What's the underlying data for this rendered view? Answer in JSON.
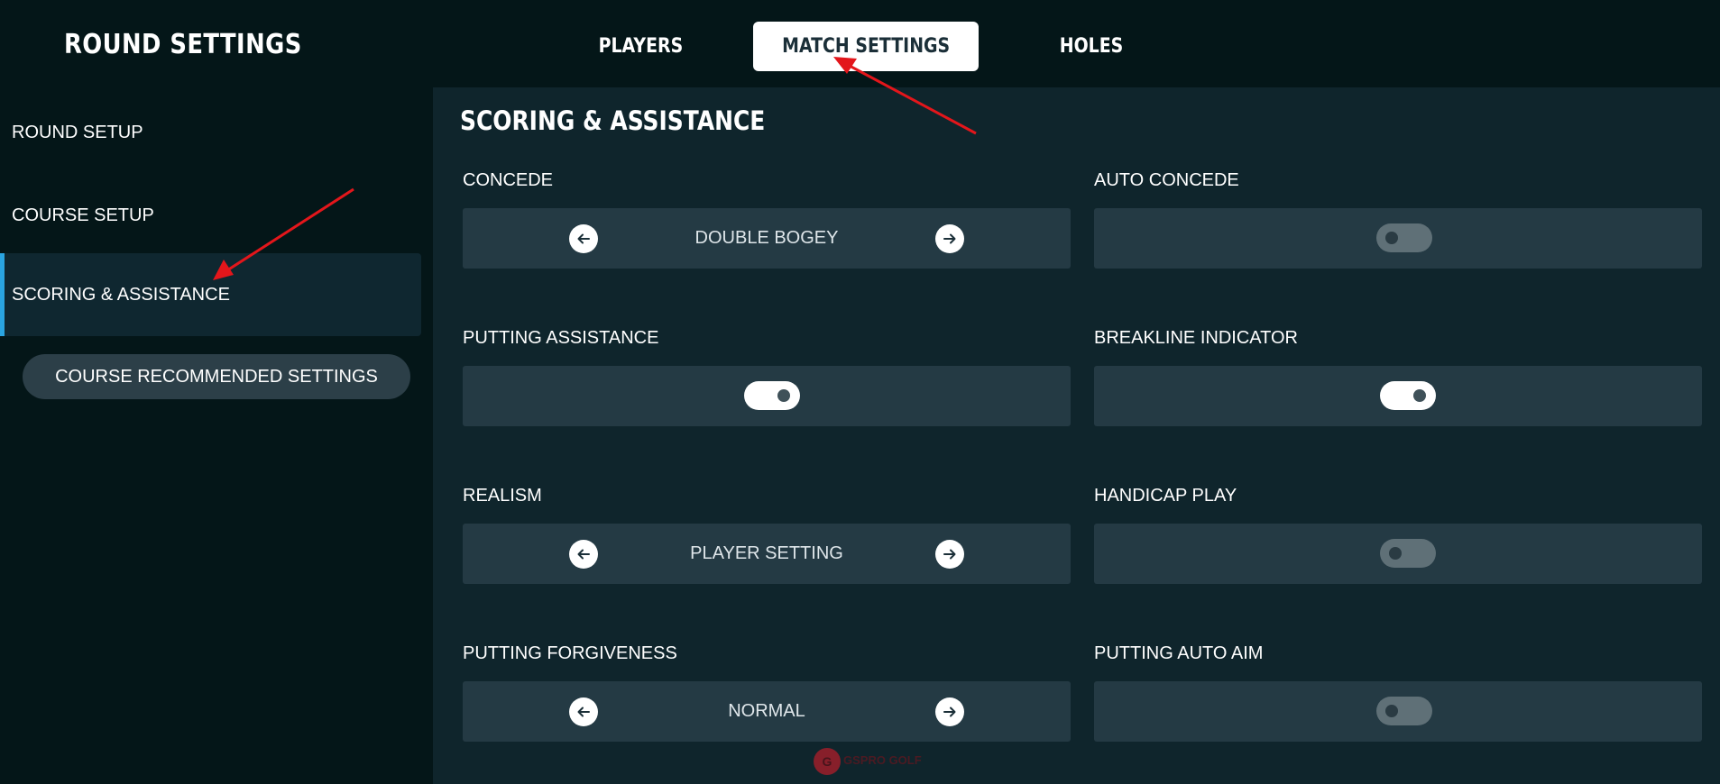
{
  "header": {
    "title": "ROUND SETTINGS",
    "tabs": [
      {
        "label": "PLAYERS",
        "active": false
      },
      {
        "label": "MATCH SETTINGS",
        "active": true
      },
      {
        "label": "HOLES",
        "active": false
      }
    ]
  },
  "sidebar": {
    "items": [
      {
        "label": "ROUND SETUP",
        "active": false
      },
      {
        "label": "COURSE SETUP",
        "active": false
      },
      {
        "label": "SCORING & ASSISTANCE",
        "active": true
      }
    ],
    "recommended_button": "COURSE RECOMMENDED SETTINGS"
  },
  "main": {
    "section_title": "SCORING & ASSISTANCE",
    "settings": {
      "concede": {
        "label": "CONCEDE",
        "value": "DOUBLE BOGEY"
      },
      "auto_concede": {
        "label": "AUTO CONCEDE",
        "enabled": false
      },
      "putting_assistance": {
        "label": "PUTTING ASSISTANCE",
        "enabled": true
      },
      "breakline_indicator": {
        "label": "BREAKLINE INDICATOR",
        "enabled": true
      },
      "realism": {
        "label": "REALISM",
        "value": "PLAYER SETTING"
      },
      "handicap_play": {
        "label": "HANDICAP PLAY",
        "enabled": false
      },
      "putting_forgiveness": {
        "label": "PUTTING FORGIVENESS",
        "value": "NORMAL"
      },
      "putting_auto_aim": {
        "label": "PUTTING AUTO AIM",
        "enabled": false
      }
    }
  },
  "watermark": {
    "text": "GSPRO GOLF"
  },
  "colors": {
    "background": "#041618",
    "panel": "#243a44",
    "accent": "#2aa4e0",
    "annotation_arrow": "#e3161b"
  }
}
